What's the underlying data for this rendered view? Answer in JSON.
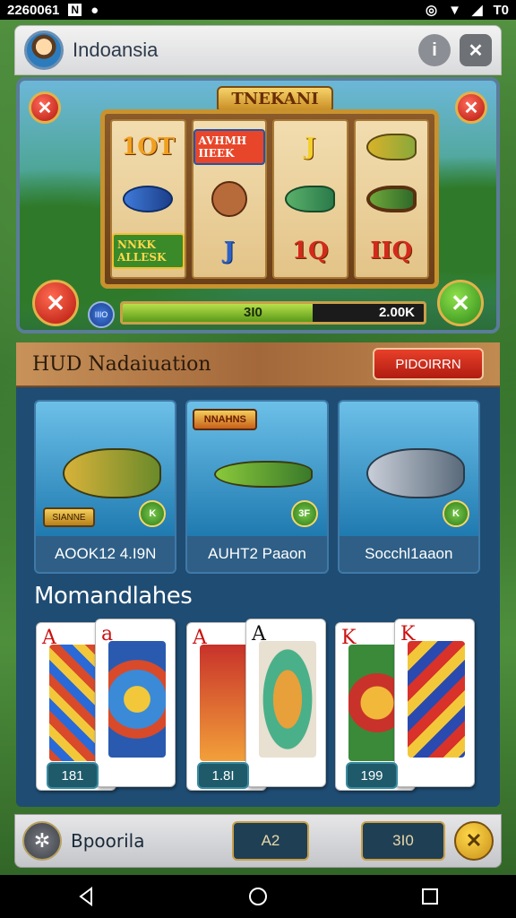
{
  "status_bar": {
    "time": "2260061",
    "right_text": "T0",
    "icons": [
      "notification-icon",
      "media-icon",
      "alarm-icon",
      "wifi-icon",
      "signal-icon"
    ]
  },
  "window": {
    "title": "Indoansia",
    "info_label": "i",
    "close_label": "✕"
  },
  "slot": {
    "banner": "TNEKANI",
    "reels": [
      [
        {
          "type": "text",
          "text": "1OT",
          "style": "gold"
        },
        {
          "type": "fish",
          "style": "blue"
        },
        {
          "type": "text",
          "text": "NNKK ALLESK",
          "style": "green"
        }
      ],
      [
        {
          "type": "text",
          "text": "AVHMH IIEEK",
          "style": "box"
        },
        {
          "type": "fish",
          "style": "brown"
        },
        {
          "type": "text",
          "text": "J",
          "style": "blue"
        }
      ],
      [
        {
          "type": "text",
          "text": "J",
          "style": "yellow"
        },
        {
          "type": "fish",
          "style": "green"
        },
        {
          "type": "text",
          "text": "1Q",
          "style": "red"
        }
      ],
      [
        {
          "type": "fish",
          "style": "gold"
        },
        {
          "type": "fish",
          "style": "framed"
        },
        {
          "type": "text",
          "text": "IIQ",
          "style": "red"
        }
      ]
    ],
    "bar_icon_label": "IIIO",
    "progress_left": "3I0",
    "progress_right": "2.00K",
    "progress_fraction": 0.63
  },
  "hud": {
    "title": "HUD Nadaiuation",
    "button_label": "PIDOIRRN"
  },
  "modes": [
    {
      "label": "AOOK12 4.I9N",
      "badge": "SIANNE",
      "corner": "K",
      "art": "angler"
    },
    {
      "label": "AUHT2 Paaon",
      "badge": "NNAHNS",
      "corner": "3F",
      "art": "lure"
    },
    {
      "label": "Socchl1aaon",
      "badge": "",
      "corner": "K",
      "art": "shark"
    }
  ],
  "section": {
    "title": "Momandlahes"
  },
  "card_pairs": [
    {
      "back_rank": "A",
      "front_rank": "a",
      "label": "181"
    },
    {
      "back_rank": "A",
      "front_rank": "A",
      "label": "1.8I"
    },
    {
      "back_rank": "K",
      "front_rank": "K",
      "label": "199"
    }
  ],
  "bottom": {
    "label": "Bpoorila",
    "field_left": "A2",
    "field_right": "3I0",
    "gold_button": "✕"
  },
  "nav": {
    "back": "◁",
    "home": "○",
    "recents": "□"
  }
}
